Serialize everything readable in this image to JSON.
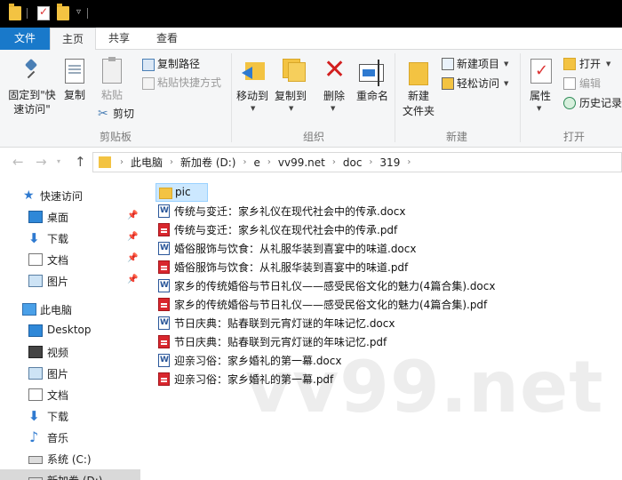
{
  "ribbon_tabs": [
    "文件",
    "主页",
    "共享",
    "查看"
  ],
  "ribbon": {
    "clipboard": {
      "pin_label_1": "固定到\"快",
      "pin_label_2": "速访问\"",
      "copy": "复制",
      "paste": "粘贴",
      "copy_path": "复制路径",
      "paste_shortcut": "粘贴快捷方式",
      "cut": "剪切",
      "group": "剪贴板"
    },
    "organize": {
      "move_to": "移动到",
      "copy_to": "复制到",
      "delete": "删除",
      "rename": "重命名",
      "group": "组织"
    },
    "new": {
      "new_folder_1": "新建",
      "new_folder_2": "文件夹",
      "new_item": "新建项目",
      "easy_access": "轻松访问",
      "group": "新建"
    },
    "open": {
      "properties": "属性",
      "open": "打开",
      "edit": "编辑",
      "history": "历史记录",
      "group": "打开"
    }
  },
  "address": {
    "crumbs": [
      "此电脑",
      "新加卷 (D:)",
      "e",
      "vv99.net",
      "doc",
      "319"
    ]
  },
  "nav_pane": {
    "quick_access": "快速访问",
    "qa_items": [
      "桌面",
      "下载",
      "文档",
      "图片"
    ],
    "this_pc": "此电脑",
    "pc_items": [
      "Desktop",
      "视频",
      "图片",
      "文档",
      "下载",
      "音乐",
      "系统 (C:)",
      "新加卷 (D:)"
    ]
  },
  "files": [
    {
      "name": "pic",
      "type": "folder"
    },
    {
      "name": "传统与变迁：家乡礼仪在现代社会中的传承.docx",
      "type": "docx"
    },
    {
      "name": "传统与变迁：家乡礼仪在现代社会中的传承.pdf",
      "type": "pdf"
    },
    {
      "name": "婚俗服饰与饮食：从礼服华装到喜宴中的味道.docx",
      "type": "docx"
    },
    {
      "name": "婚俗服饰与饮食：从礼服华装到喜宴中的味道.pdf",
      "type": "pdf"
    },
    {
      "name": "家乡的传统婚俗与节日礼仪——感受民俗文化的魅力(4篇合集).docx",
      "type": "docx"
    },
    {
      "name": "家乡的传统婚俗与节日礼仪——感受民俗文化的魅力(4篇合集).pdf",
      "type": "pdf"
    },
    {
      "name": "节日庆典：贴春联到元宵灯谜的年味记忆.docx",
      "type": "docx"
    },
    {
      "name": "节日庆典：贴春联到元宵灯谜的年味记忆.pdf",
      "type": "pdf"
    },
    {
      "name": "迎亲习俗：家乡婚礼的第一幕.docx",
      "type": "docx"
    },
    {
      "name": "迎亲习俗：家乡婚礼的第一幕.pdf",
      "type": "pdf"
    }
  ],
  "watermark": "vv99.net",
  "colors": {
    "file_tab": "#1979ca",
    "folder": "#f3c342",
    "pdf": "#d9272e",
    "word": "#2b579a",
    "selection": "#cce8ff"
  }
}
